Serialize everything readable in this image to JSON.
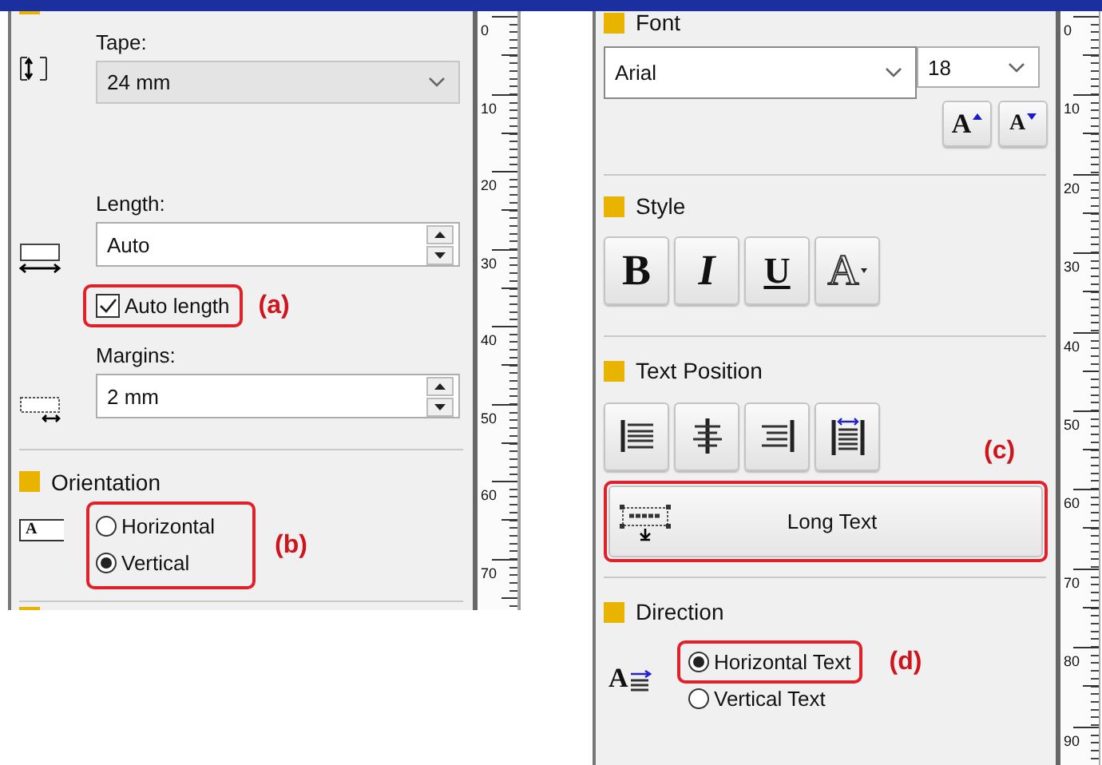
{
  "left_panel": {
    "tape_size": {
      "tape_label": "Tape:",
      "tape_value": "24 mm",
      "length_label": "Length:",
      "length_value": "Auto",
      "auto_length": {
        "label": "Auto length",
        "checked": true,
        "highlighted": true,
        "annotation": "(a)"
      },
      "margins_label": "Margins:",
      "margins_value": "2 mm"
    },
    "orientation": {
      "title": "Orientation",
      "icon_letter": "A",
      "highlighted": true,
      "annotation": "(b)",
      "options": [
        {
          "label": "Horizontal",
          "selected": false
        },
        {
          "label": "Vertical",
          "selected": true
        }
      ]
    },
    "ruler_labels": [
      "0",
      "10",
      "20",
      "30",
      "40",
      "50",
      "60",
      "70"
    ]
  },
  "right_panel": {
    "font": {
      "title": "Font",
      "family": "Arial",
      "size": "18",
      "size_buttons": [
        {
          "kind": "increase",
          "label": "A"
        },
        {
          "kind": "decrease",
          "label": "A"
        }
      ]
    },
    "style": {
      "title": "Style",
      "buttons": [
        {
          "kind": "bold",
          "label": "B"
        },
        {
          "kind": "italic",
          "label": "I"
        },
        {
          "kind": "underline",
          "label": "U"
        },
        {
          "kind": "outline",
          "label": "A"
        }
      ]
    },
    "text_position": {
      "title": "Text Position",
      "align_buttons": [
        {
          "kind": "left"
        },
        {
          "kind": "center"
        },
        {
          "kind": "right"
        },
        {
          "kind": "justify"
        }
      ],
      "annotation": "(c)",
      "long_text": {
        "label": "Long Text",
        "highlighted": true
      }
    },
    "direction": {
      "title": "Direction",
      "icon_letter": "A",
      "options": [
        {
          "label": "Horizontal Text",
          "selected": true,
          "highlighted": true,
          "annotation": "(d)"
        },
        {
          "label": "Vertical Text",
          "selected": false,
          "highlighted": false
        }
      ]
    },
    "ruler_labels": [
      "0",
      "10",
      "20",
      "30",
      "40",
      "50",
      "60",
      "70",
      "80",
      "90"
    ]
  }
}
